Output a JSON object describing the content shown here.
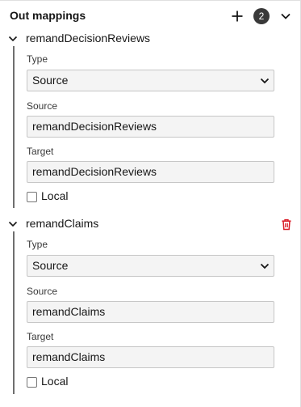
{
  "header": {
    "title": "Out mappings",
    "count": "2",
    "add_icon": "plus-icon",
    "collapse_icon": "chevron-down-icon"
  },
  "mappings": [
    {
      "name": "remandDecisionReviews",
      "type_label": "Type",
      "type_value": "Source",
      "source_label": "Source",
      "source_value": "remandDecisionReviews",
      "target_label": "Target",
      "target_value": "remandDecisionReviews",
      "local_label": "Local",
      "local_checked": false
    },
    {
      "name": "remandClaims",
      "type_label": "Type",
      "type_value": "Source",
      "source_label": "Source",
      "source_value": "remandClaims",
      "target_label": "Target",
      "target_value": "remandClaims",
      "local_label": "Local",
      "local_checked": false,
      "delete_icon": "trash-icon"
    }
  ],
  "colors": {
    "accent_delete": "#da1e28",
    "rail": "#6f6f6f",
    "badge_bg": "#393939",
    "field_bg": "#f4f4f4"
  }
}
